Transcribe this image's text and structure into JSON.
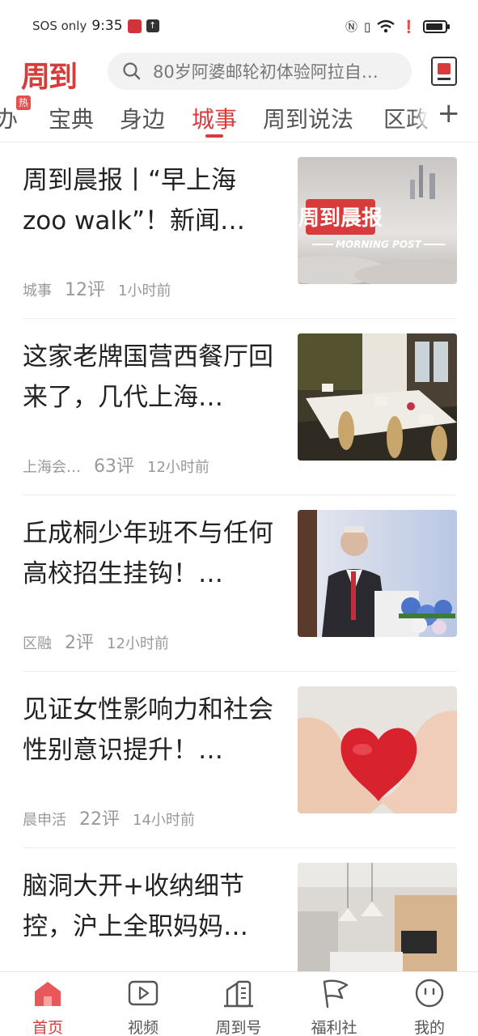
{
  "status_bar": {
    "carrier": "SOS only",
    "time": "9:35"
  },
  "header": {
    "logo": "周到",
    "search_placeholder": "80岁阿婆邮轮初体验阿拉自…"
  },
  "tabs": {
    "hot_badge": "热",
    "items": [
      {
        "label": "办"
      },
      {
        "label": "宝典"
      },
      {
        "label": "身边"
      },
      {
        "label": "城事"
      },
      {
        "label": "周到说法"
      },
      {
        "label": "区政"
      }
    ],
    "active": "城事",
    "add_label": "+"
  },
  "feed": {
    "items": [
      {
        "title": "周到晨报丨“早上海zoo walk”！新闻…",
        "source": "城事",
        "comments": "12评",
        "time": "1小时前",
        "image": "morning-post-cover",
        "image_text": "周到晨报",
        "image_sub": "MORNING POST"
      },
      {
        "title": "这家老牌国营西餐厅回来了，几代上海…",
        "source": "上海会…",
        "comments": "63评",
        "time": "12小时前",
        "image": "restaurant-interior"
      },
      {
        "title": "丘成桐少年班不与任何高校招生挂钩！…",
        "source": "区融",
        "comments": "2评",
        "time": "12小时前",
        "image": "speaker-podium"
      },
      {
        "title": "见证女性影响力和社会性别意识提升！…",
        "source": "晨申活",
        "comments": "22评",
        "time": "14小时前",
        "image": "heart-in-hands"
      },
      {
        "title": "脑洞大开+收纳细节控，沪上全职妈妈…",
        "source": "",
        "comments": "",
        "time": "",
        "image": "home-interior"
      }
    ]
  },
  "bottom_nav": {
    "items": [
      {
        "label": "首页",
        "icon": "home-icon"
      },
      {
        "label": "视频",
        "icon": "video-icon"
      },
      {
        "label": "周到号",
        "icon": "building-icon"
      },
      {
        "label": "福利社",
        "icon": "flag-icon"
      },
      {
        "label": "我的",
        "icon": "profile-icon"
      }
    ],
    "active": "首页"
  },
  "colors": {
    "accent": "#d83b3b",
    "text": "#222222",
    "muted": "#999999"
  }
}
